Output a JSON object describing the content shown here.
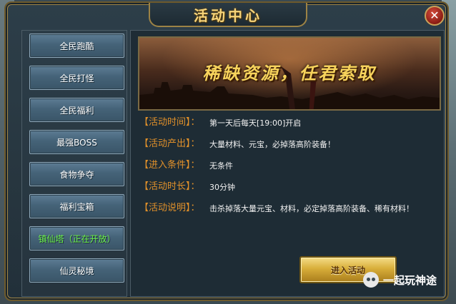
{
  "window": {
    "title": "活动中心",
    "close_glyph": "✕"
  },
  "sidebar": {
    "items": [
      {
        "label": "全民跑酷",
        "active": false
      },
      {
        "label": "全民打怪",
        "active": false
      },
      {
        "label": "全民福利",
        "active": false
      },
      {
        "label": "最强BOSS",
        "active": false
      },
      {
        "label": "食物争夺",
        "active": false
      },
      {
        "label": "福利宝箱",
        "active": false
      },
      {
        "label": "镇仙塔（正在开放）",
        "active": true
      },
      {
        "label": "仙灵秘境",
        "active": false
      }
    ]
  },
  "banner": {
    "text": "稀缺资源，任君索取"
  },
  "details": {
    "time_label": "【活动时间】：",
    "time_value": "第一天后每天[19:00]开启",
    "output_label": "【活动产出】：",
    "output_value": "大量材料、元宝，必掉落高阶装备！",
    "condition_label": "【进入条件】：",
    "condition_value": "无条件",
    "duration_label": "【活动时长】：",
    "duration_value": "30分钟",
    "desc_label": "【活动说明】：",
    "desc_value": "击杀掉落大量元宝、材料，必定掉落高阶装备、稀有材料！"
  },
  "actions": {
    "enter_label": "进入活动"
  },
  "watermark": {
    "text": "一起玩神途",
    "icon": "wechat-icon"
  },
  "colors": {
    "title": "#f6d47a",
    "label": "#e0902a",
    "active_item": "#6cf24a",
    "button_gold": "#d8ae3a"
  }
}
